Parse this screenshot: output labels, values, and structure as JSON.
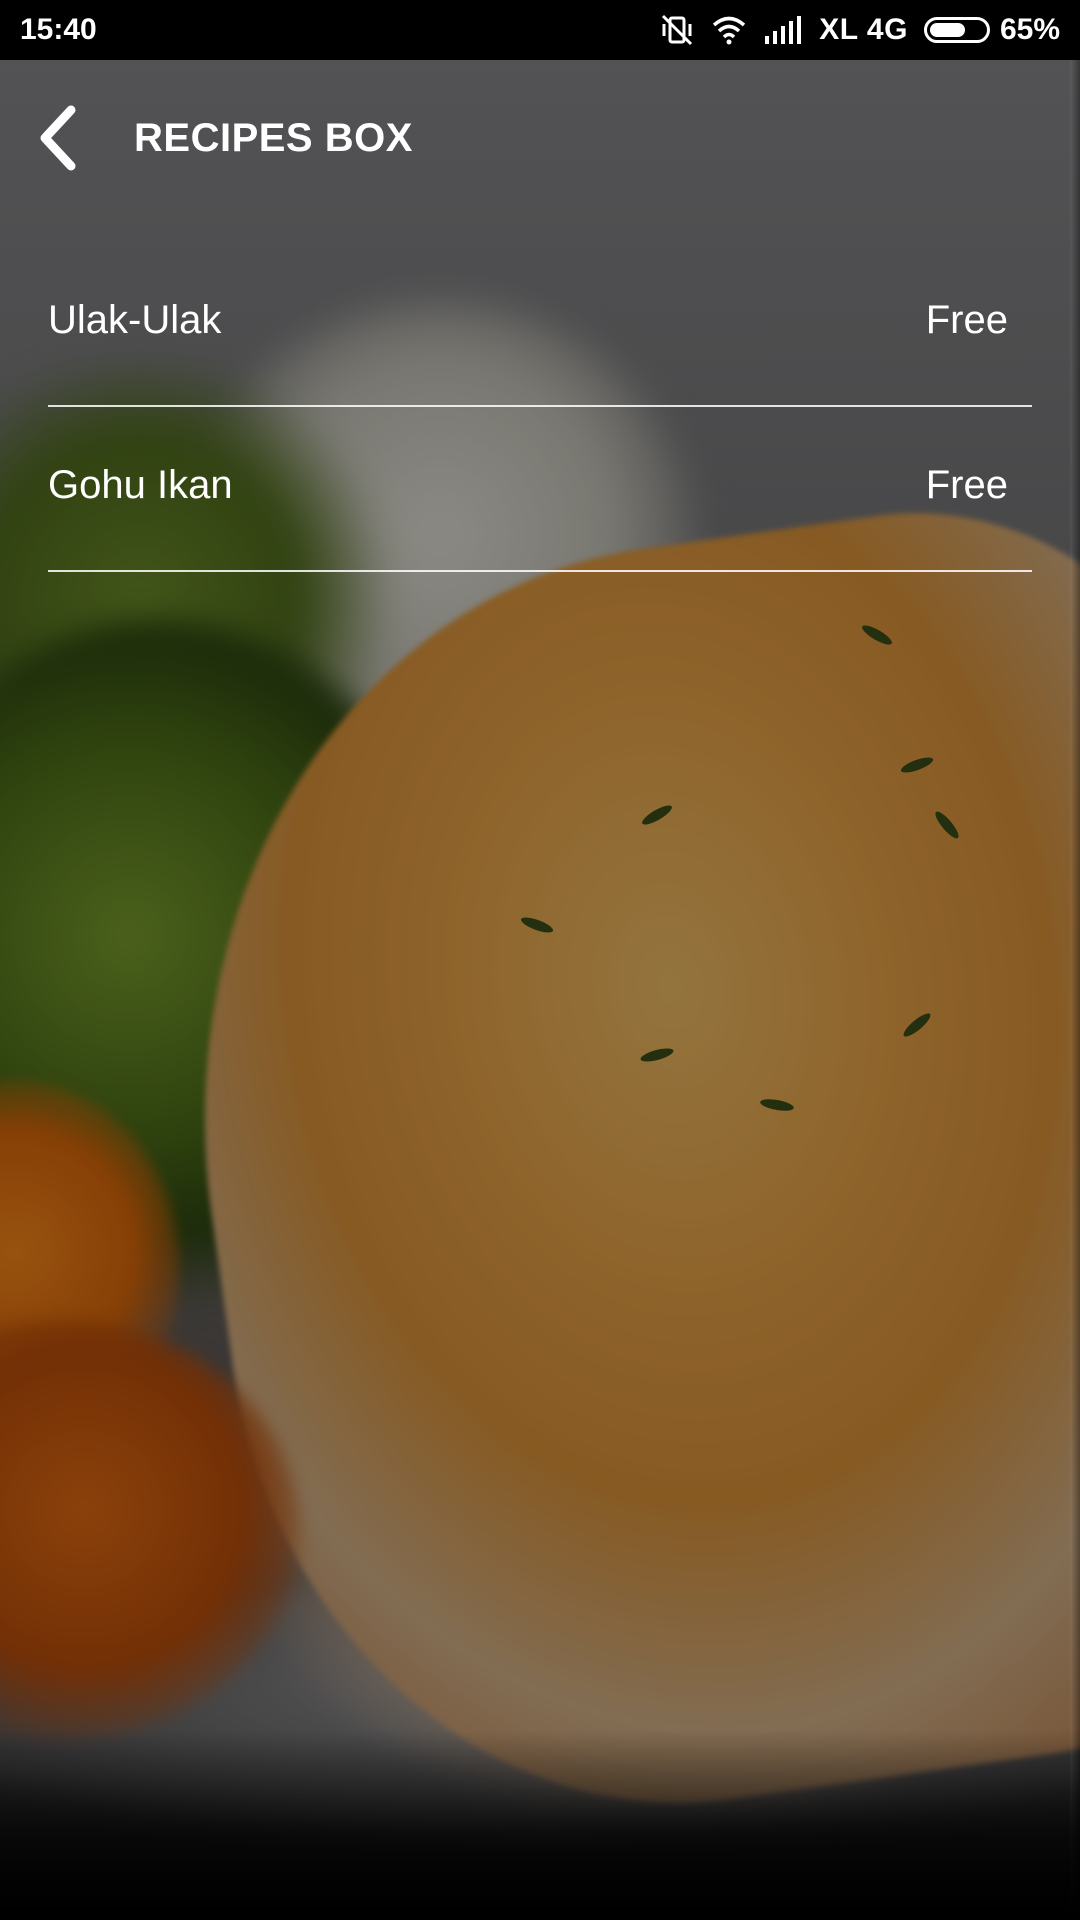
{
  "status_bar": {
    "time": "15:40",
    "network": "XL 4G",
    "battery_percent": "65%",
    "battery_level": 0.65,
    "icons": [
      "vibrate-off-icon",
      "wifi-icon",
      "signal-icon",
      "battery-icon"
    ]
  },
  "app_bar": {
    "title": "RECIPES BOX",
    "back_icon": "chevron-left-icon"
  },
  "recipes": [
    {
      "name": "Ulak-Ulak",
      "price": "Free"
    },
    {
      "name": "Gohu Ikan",
      "price": "Free"
    }
  ],
  "colors": {
    "text": "#ffffff",
    "status_bar_bg": "#000000",
    "divider": "#ffffff"
  }
}
